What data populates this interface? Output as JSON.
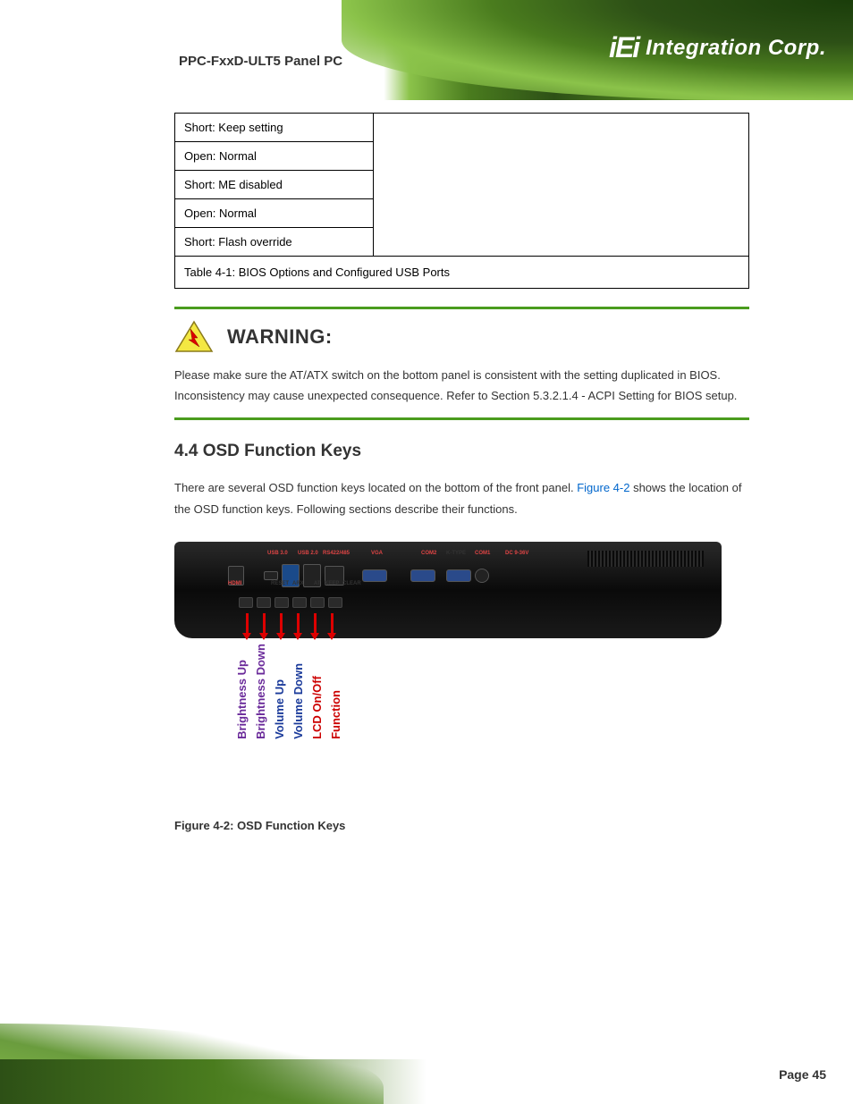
{
  "docTitleTop": "PPC-FxxD-ULT5 Panel PC",
  "logo": {
    "brand": "iEi",
    "text": "Integration Corp."
  },
  "table": {
    "rows": [
      {
        "label": "Short: Keep setting"
      },
      {
        "label": "Open: Normal"
      },
      {
        "label": "Short: ME disabled"
      },
      {
        "label": "Open: Normal"
      },
      {
        "label": "Short: Flash override"
      }
    ],
    "caption": "Table 4-1: BIOS Options and Configured USB Ports"
  },
  "warning": {
    "title": "WARNING:",
    "text": "Please make sure the AT/ATX switch on the bottom panel is consistent with the setting duplicated in BIOS. Inconsistency may cause unexpected consequence. Refer to Section 5.3.2.1.4 - ACPI Setting for BIOS setup."
  },
  "section": {
    "heading": "4.4 OSD Function Keys",
    "body": "There are several OSD function keys located on the bottom of the front panel. Figure 4-2 shows the location of the OSD function keys. Following sections describe their functions."
  },
  "portLabels": {
    "usb30": "USB 3.0",
    "usb20": "USB 2.0",
    "rs422": "RS422/485",
    "hdmi": "HDMI",
    "reset": "RESET",
    "arx": "ARX",
    "at": "AT",
    "keep": "KEEP",
    "clear": "CLEAR",
    "vga": "VGA",
    "com2": "COM2",
    "ktype": "K-TYPE",
    "com1": "COM1",
    "dc": "DC 9-36V"
  },
  "callouts": [
    {
      "text": "Brightness Up",
      "cls": "purple"
    },
    {
      "text": "Brightness Down",
      "cls": "purple"
    },
    {
      "text": "Volume Up",
      "cls": "blue"
    },
    {
      "text": "Volume Down",
      "cls": "blue"
    },
    {
      "text": "LCD On/Off",
      "cls": "red"
    },
    {
      "text": "Function",
      "cls": "red"
    }
  ],
  "figureCaption": "Figure 4-2: OSD Function Keys",
  "pageNumber": "Page 45"
}
